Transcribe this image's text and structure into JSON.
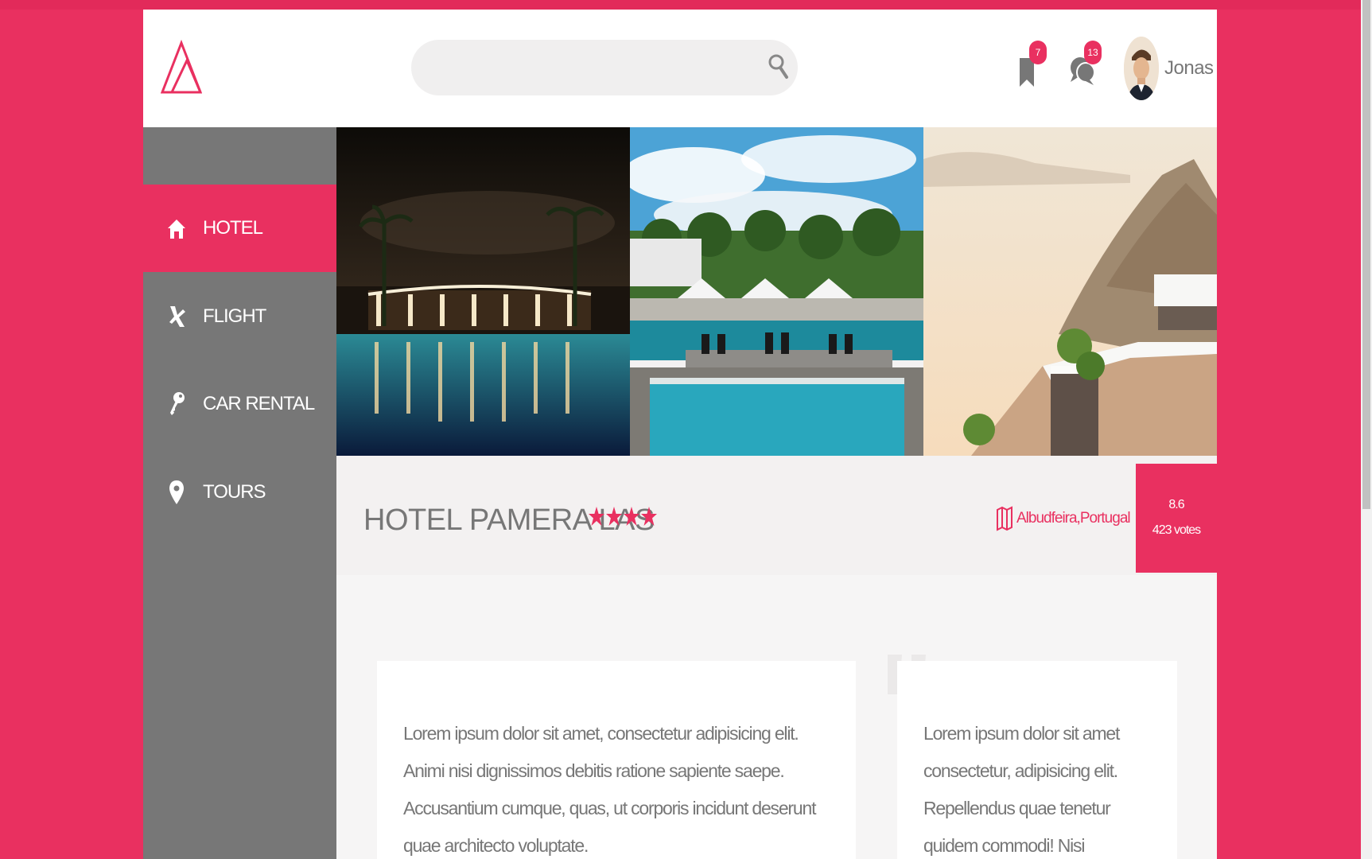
{
  "header": {
    "search": {
      "placeholder": "",
      "value": ""
    },
    "bookmarks": {
      "count": "7"
    },
    "messages": {
      "count": "13"
    },
    "user": {
      "name": "Jonas"
    }
  },
  "sidebar": {
    "items": [
      {
        "label": "HOTEL",
        "icon": "home-icon",
        "active": true
      },
      {
        "label": "FLIGHT",
        "icon": "plane-icon",
        "active": false
      },
      {
        "label": "CAR RENTAL",
        "icon": "key-icon",
        "active": false
      },
      {
        "label": "TOURS",
        "icon": "map-pin-icon",
        "active": false
      }
    ]
  },
  "gallery": {
    "photos": [
      {
        "name": "hotel-pool-night"
      },
      {
        "name": "hotel-pool-day"
      },
      {
        "name": "cliffside-terrace"
      }
    ]
  },
  "hotel": {
    "name": "HOTEL PAMERA LAS",
    "stars": 4,
    "location": "Albudfeira,Portugal",
    "rating": {
      "score": "8.6",
      "votes": "423 votes"
    }
  },
  "content": {
    "main_text": "Lorem ipsum dolor sit amet, consectetur adipisicing elit. Animi nisi dignissimos debitis ratione sapiente saepe. Accusantium cumque, quas, ut corporis incidunt deserunt quae architecto voluptate.",
    "side_text": "Lorem ipsum dolor sit amet consectetur, adipisicing elit. Repellendus quae tenetur quidem commodi! Nisi voluptates, dolorum"
  },
  "colors": {
    "accent": "#e93060",
    "sidebar": "#777777",
    "text": "#777777"
  }
}
